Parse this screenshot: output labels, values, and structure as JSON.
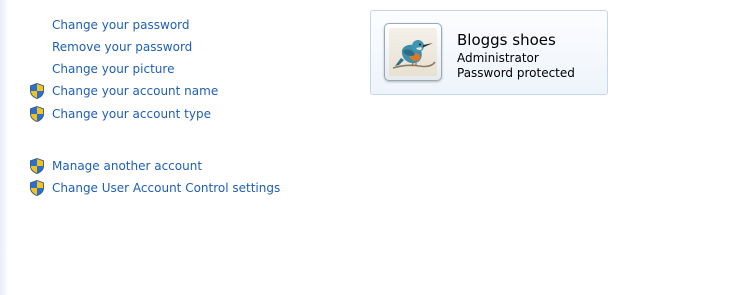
{
  "tasks": {
    "items": [
      {
        "label": "Change your password",
        "shield": false
      },
      {
        "label": "Remove your password",
        "shield": false
      },
      {
        "label": "Change your picture",
        "shield": false
      },
      {
        "label": "Change your account name",
        "shield": true
      },
      {
        "label": "Change your account type",
        "shield": true
      }
    ],
    "items2": [
      {
        "label": "Manage another account",
        "shield": true
      },
      {
        "label": "Change User Account Control settings",
        "shield": true
      }
    ]
  },
  "account": {
    "name": "Bloggs shoes",
    "type": "Administrator",
    "password_status": "Password protected",
    "picture": "kingfisher-bird-picture"
  },
  "colors": {
    "link": "#1e5fb4",
    "card_border": "#c7d7ea"
  }
}
